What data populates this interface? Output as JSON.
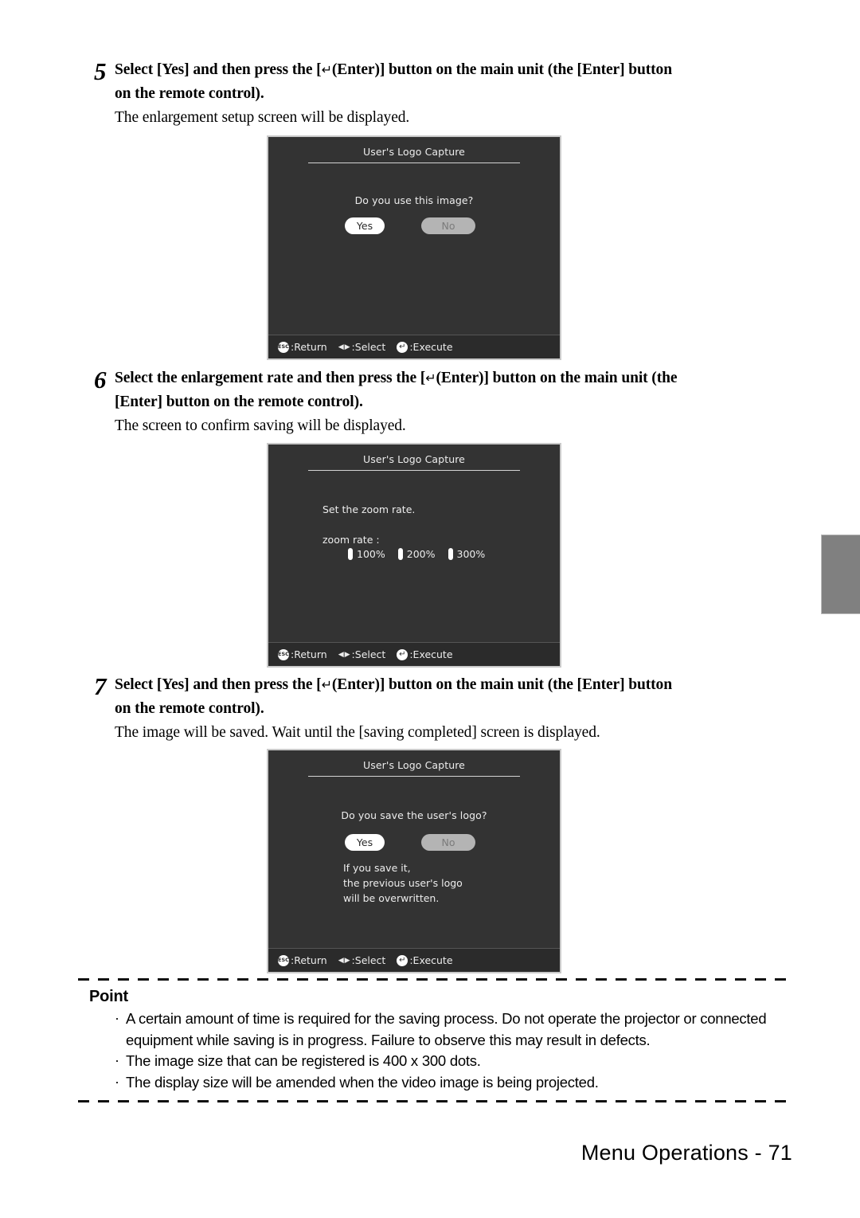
{
  "document": {
    "footer_text": "Menu Operations - 71"
  },
  "steps": [
    {
      "number": "5",
      "title_line1_a": "Select [Yes] and then press the [",
      "title_enter_glyph": "↵",
      "title_line1_b": "(Enter)] button on the main unit (the [Enter] button",
      "title_line2": "on the remote control).",
      "description": "The enlargement setup screen will be displayed."
    },
    {
      "number": "6",
      "title_line1_a": "Select the enlargement rate and then press the [",
      "title_enter_glyph": "↵",
      "title_line1_b": "(Enter)] button on the main unit (the",
      "title_line2": "[Enter] button on the remote control).",
      "description": "The screen to confirm saving will be displayed."
    },
    {
      "number": "7",
      "title_line1_a": "Select [Yes] and then press the [",
      "title_enter_glyph": "↵",
      "title_line1_b": "(Enter)] button on the main unit (the [Enter] button",
      "title_line2": "on the remote control).",
      "description": "The image will be saved. Wait until the [saving completed] screen is displayed."
    }
  ],
  "osd_common": {
    "title": "User's Logo Capture",
    "status_bar": {
      "return_icon": "esc-icon",
      "return_label": ":Return",
      "select_icon": "left-right-arrows-icon",
      "select_label": ":Select",
      "execute_icon": "enter-icon",
      "execute_label": ":Execute",
      "esc_text": "ESC",
      "enter_glyph": "↵",
      "left_glyph": "◀",
      "right_glyph": "▶"
    },
    "colors": {
      "screen_bg": "#333333",
      "status_bar_bg": "#2b2b2b",
      "border": "#c9c9c9",
      "selected_pill_bg": "#ffffff",
      "unselected_pill_bg": "#b4b4b4",
      "text": "#ededed"
    }
  },
  "osd_screens": [
    {
      "id": "use-image-confirm",
      "question": "Do you use this image?",
      "buttons": [
        {
          "label": "Yes",
          "selected": true
        },
        {
          "label": "No",
          "selected": false
        }
      ]
    },
    {
      "id": "zoom-rate",
      "prompt": "Set the zoom rate.",
      "field_label": "zoom rate :",
      "options": [
        {
          "label": "100%"
        },
        {
          "label": "200%"
        },
        {
          "label": "300%"
        }
      ]
    },
    {
      "id": "save-logo-confirm",
      "question": "Do you save the user's logo?",
      "buttons": [
        {
          "label": "Yes",
          "selected": true
        },
        {
          "label": "No",
          "selected": false
        }
      ],
      "note_line1": "If you save it,",
      "note_line2": "the previous user's logo",
      "note_line3": "will be overwritten."
    }
  ],
  "point": {
    "title": "Point",
    "bullet_glyph": "·",
    "items": [
      "A certain amount of time is required for the saving process. Do not operate the projector or connected equipment while saving is in progress. Failure to observe this may result in defects.",
      "The image size that can be registered is 400 x 300 dots.",
      "The display size will be amended when the video image is being projected."
    ]
  }
}
